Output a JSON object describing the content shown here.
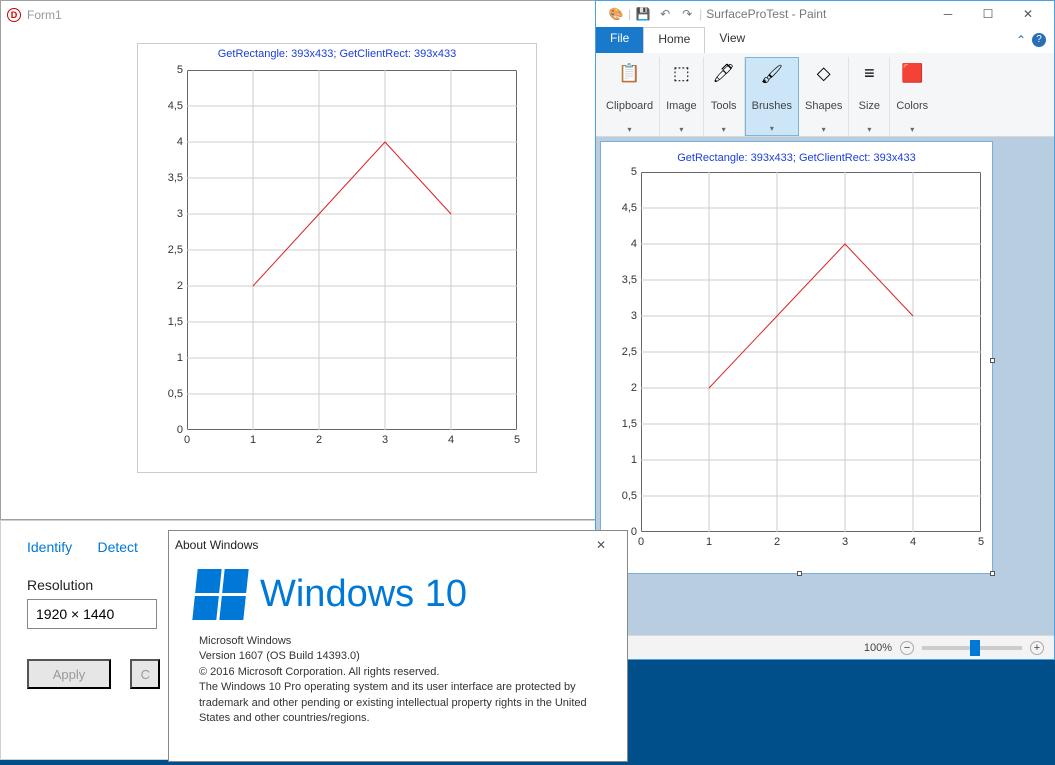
{
  "form1": {
    "title": "Form1",
    "chart_title": "GetRectangle: 393x433; GetClientRect: 393x433"
  },
  "panel": {
    "tab_identify": "Identify",
    "tab_detect": "Detect",
    "resolution_label": "Resolution",
    "resolution_value": "1920 × 1440",
    "apply": "Apply",
    "other": "C"
  },
  "paint": {
    "title": "SurfaceProTest - Paint",
    "tabs": {
      "file": "File",
      "home": "Home",
      "view": "View"
    },
    "ribbon": {
      "clipboard": "Clipboard",
      "image": "Image",
      "tools": "Tools",
      "brushes": "Brushes",
      "shapes": "Shapes",
      "size": "Size",
      "colors": "Colors"
    },
    "chart_title": "GetRectangle: 393x433; GetClientRect: 393x433",
    "zoom": "100%"
  },
  "about": {
    "title": "About Windows",
    "brand": "Windows 10",
    "line1": "Microsoft Windows",
    "line2": "Version 1607 (OS Build 14393.0)",
    "line3": "© 2016 Microsoft Corporation. All rights reserved.",
    "line4": "The Windows 10 Pro operating system and its user interface are protected by trademark and other pending or existing intellectual property rights in the United States and other countries/regions."
  },
  "chart_data": {
    "type": "line",
    "title": "GetRectangle: 393x433; GetClientRect: 393x433",
    "x": [
      1,
      2,
      3,
      4
    ],
    "y": [
      2,
      3,
      4,
      3
    ],
    "xlim": [
      0,
      5
    ],
    "ylim": [
      0,
      5
    ],
    "xticks": [
      0,
      1,
      2,
      3,
      4,
      5
    ],
    "yticks": [
      0,
      0.5,
      1,
      1.5,
      2,
      2.5,
      3,
      3.5,
      4,
      4.5,
      5
    ],
    "ytick_labels": [
      "0",
      "0,5",
      "1",
      "1,5",
      "2",
      "2,5",
      "3",
      "3,5",
      "4",
      "4,5",
      "5"
    ]
  }
}
